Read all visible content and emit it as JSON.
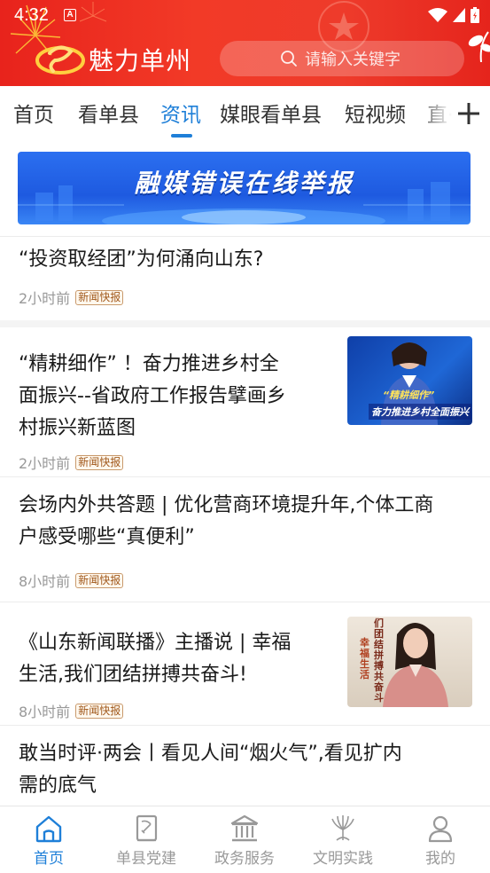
{
  "status_bar": {
    "time": "4:32",
    "notification_icon": "A"
  },
  "header": {
    "app_title": "魅力单州",
    "search_placeholder": "请输入关键字"
  },
  "tabs": [
    {
      "label": "首页"
    },
    {
      "label": "看单县"
    },
    {
      "label": "资讯",
      "active": true
    },
    {
      "label": "媒眼看单县"
    },
    {
      "label": "短视频"
    },
    {
      "label": "直·"
    }
  ],
  "banner": {
    "text": "融媒错误在线举报"
  },
  "news": [
    {
      "title": "“投资取经团”为何涌向山东?",
      "time": "2小时前",
      "tag": "新闻快报",
      "has_thumb": false
    },
    {
      "title": "“精耕细作” ！奋力推进乡村全面振兴--省政府工作报告擘画乡村振兴新蓝图",
      "title_lines": [
        "“精耕细作” ！奋力推进乡村全",
        "面振兴--省政府工作报告擘画乡",
        "村振兴新蓝图"
      ],
      "time": "2小时前",
      "tag": "新闻快报",
      "has_thumb": true,
      "thumb_caption_1": "“精耕细作”",
      "thumb_caption_2": "奋力推进乡村全面振兴"
    },
    {
      "title": "会场内外共答题 | 优化营商环境提升年,个体工商户感受哪些“真便利”",
      "title_lines": [
        "会场内外共答题 | 优化营商环境提升年,个体工商",
        "户感受哪些“真便利”"
      ],
      "time": "8小时前",
      "tag": "新闻快报",
      "has_thumb": false
    },
    {
      "title": "《山东新闻联播》主播说 | 幸福生活,我们团结拼搏共奋斗!",
      "title_lines": [
        "《山东新闻联播》主播说 | 幸福",
        "生活,我们团结拼搏共奋斗!"
      ],
      "time": "8小时前",
      "tag": "新闻快报",
      "has_thumb": true,
      "thumb_caption_1": "们团结拼搏共奋斗",
      "thumb_caption_2": "幸福生活"
    },
    {
      "title": "敢当时评·两会丨看见人间“烟火气”,看见扩内需的底气",
      "title_lines": [
        "敢当时评·两会丨看见人间“烟火气”,看见扩内",
        "需的底气"
      ],
      "has_thumb": false
    }
  ],
  "bottom_nav": [
    {
      "label": "首页",
      "icon": "home-icon",
      "active": true
    },
    {
      "label": "单县党建",
      "icon": "party-book-icon"
    },
    {
      "label": "政务服务",
      "icon": "government-building-icon"
    },
    {
      "label": "文明实践",
      "icon": "civilization-emblem-icon"
    },
    {
      "label": "我的",
      "icon": "user-icon"
    }
  ],
  "colors": {
    "header_red": "#ee3b2b",
    "accent_blue": "#1e7fd8",
    "tag_brown": "#a0581b",
    "banner_blue": "#1e5ae0"
  }
}
